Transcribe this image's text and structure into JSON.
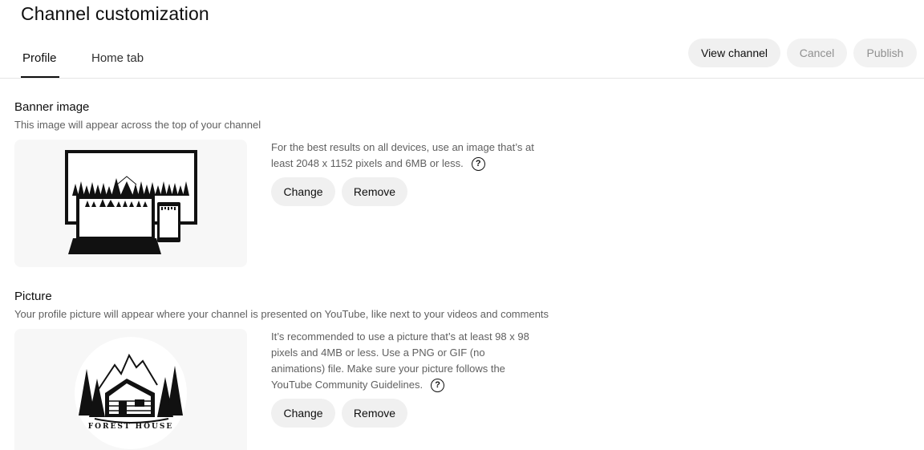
{
  "header": {
    "title": "Channel customization"
  },
  "tabs": [
    {
      "label": "Profile",
      "active": true
    },
    {
      "label": "Home tab",
      "active": false
    }
  ],
  "actions": {
    "view_channel": "View channel",
    "cancel": "Cancel",
    "publish": "Publish"
  },
  "banner": {
    "title": "Banner image",
    "description": "This image will appear across the top of your channel",
    "info": "For the best results on all devices, use an image that’s at least 2048 x 1152 pixels and 6MB or less.",
    "change_label": "Change",
    "remove_label": "Remove"
  },
  "picture": {
    "title": "Picture",
    "description": "Your profile picture will appear where your channel is presented on YouTube, like next to your videos and comments",
    "info": "It’s recommended to use a picture that’s at least 98 x 98 pixels and 4MB or less. Use a PNG or GIF (no animations) file. Make sure your picture follows the YouTube Community Guidelines.",
    "logo_text": "FOREST HOUSE",
    "change_label": "Change",
    "remove_label": "Remove"
  },
  "icons": {
    "help": "question-circle-icon"
  },
  "colors": {
    "text": "#0f0f0f",
    "secondary": "#606060",
    "button_bg": "#f0f0f0",
    "disabled_text": "#909090"
  }
}
